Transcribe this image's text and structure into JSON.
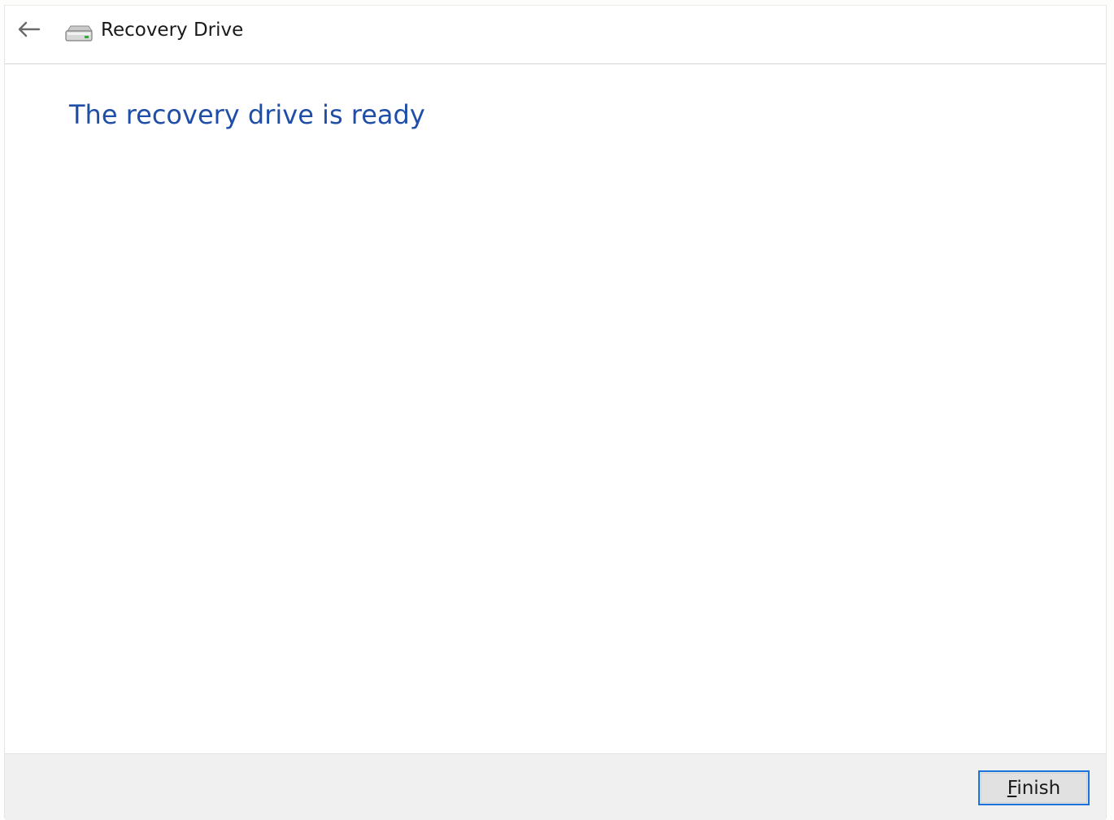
{
  "header": {
    "back_icon": "back-arrow-icon",
    "drive_icon": "usb-drive-icon",
    "title": "Recovery Drive"
  },
  "main": {
    "heading": "The recovery drive is ready"
  },
  "footer": {
    "finish_label": "Finish",
    "finish_accelerator": "F"
  },
  "colors": {
    "heading": "#1f4ea8",
    "button_focus_border": "#1a73d8",
    "footer_bg": "#f0f0f0"
  }
}
